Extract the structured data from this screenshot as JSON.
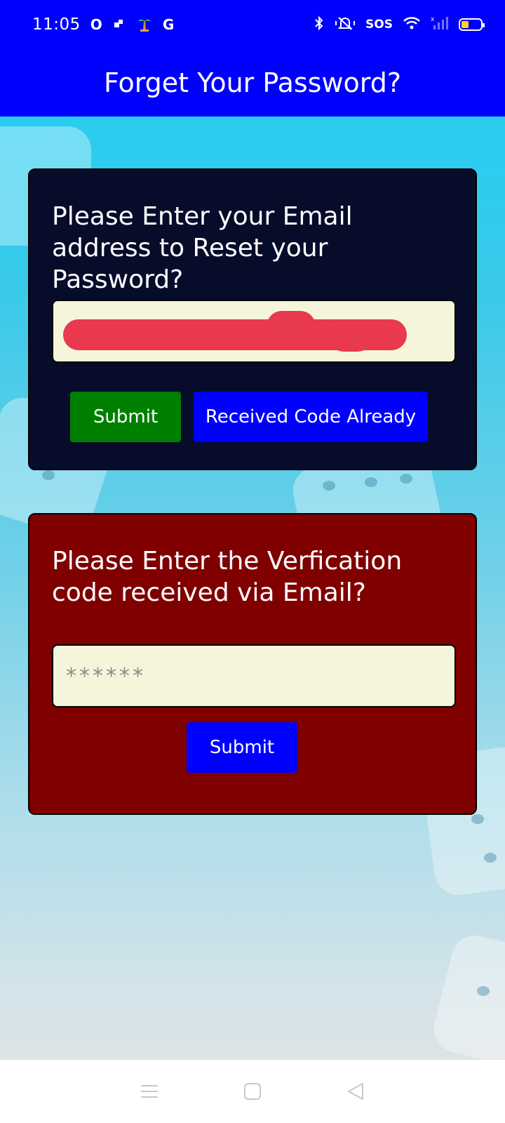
{
  "status_bar": {
    "time": "11:05",
    "sos": "SOS",
    "icons": [
      "opera-icon",
      "notification-icon",
      "palm-tree-icon",
      "google-icon",
      "bluetooth-icon",
      "mute-icon",
      "wifi-icon",
      "signal-icon",
      "battery-icon"
    ]
  },
  "header": {
    "title": "Forget Your Password?"
  },
  "email_card": {
    "prompt": "Please Enter your Email address to Reset your Password?",
    "email_value_redacted": true,
    "submit_label": "Submit",
    "received_code_label": "Received Code Already"
  },
  "code_card": {
    "prompt": "Please Enter the Verfication code received via Email?",
    "code_placeholder": "******",
    "submit_label": "Submit"
  },
  "colors": {
    "header": "#0000ff",
    "email_card": "#080c2b",
    "code_card": "#800000",
    "input_bg": "#f5f5dc",
    "submit_green": "#008000",
    "button_blue": "#0000ff",
    "redaction": "#e8394f"
  },
  "nav_bar": {
    "icons": [
      "menu-icon",
      "home-icon",
      "back-icon"
    ]
  }
}
